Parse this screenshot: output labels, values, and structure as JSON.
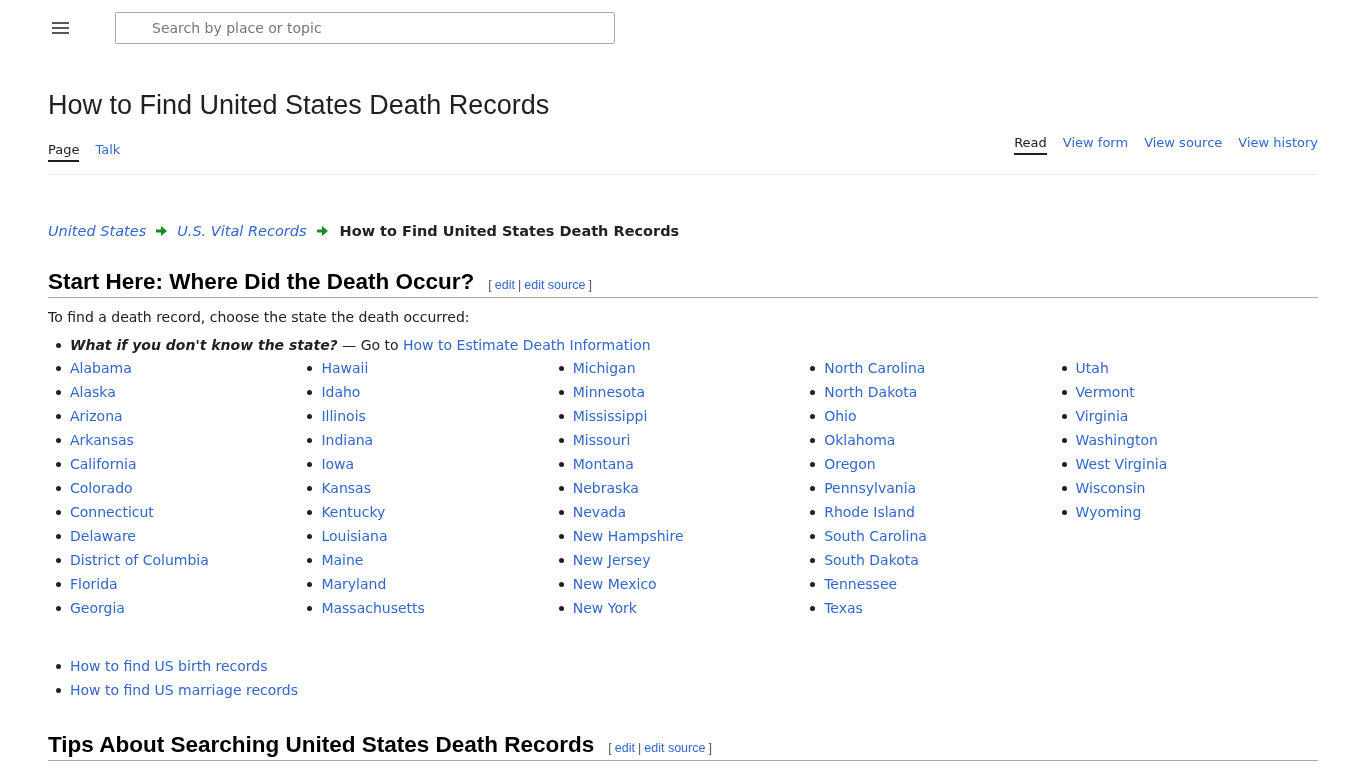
{
  "header": {
    "search": {
      "placeholder": "Search by place or topic"
    }
  },
  "page_title": "How to Find United States Death Records",
  "tabs_left": [
    {
      "label": "Page",
      "selected": true
    },
    {
      "label": "Talk",
      "selected": false
    }
  ],
  "tabs_right": [
    {
      "label": "Read",
      "selected": true
    },
    {
      "label": "View form",
      "selected": false
    },
    {
      "label": "View source",
      "selected": false
    },
    {
      "label": "View history",
      "selected": false
    }
  ],
  "breadcrumb": {
    "links": [
      "United States",
      "U.S. Vital Records"
    ],
    "current": "How to Find United States Death Records"
  },
  "sections": [
    {
      "heading": "Start Here: Where Did the Death Occur?",
      "edit": {
        "open": "[",
        "links": [
          "edit",
          "edit source"
        ],
        "separator": "|",
        "close": "]"
      },
      "intro": "To find a death record, choose the state the death occurred:",
      "tip": {
        "question": "What if you don't know the state?",
        "text": "— Go to",
        "link": "How to Estimate Death Information"
      },
      "state_columns": [
        [
          "Alabama",
          "Alaska",
          "Arizona",
          "Arkansas",
          "California",
          "Colorado",
          "Connecticut",
          "Delaware",
          "District of Columbia",
          "Florida",
          "Georgia"
        ],
        [
          "Hawaii",
          "Idaho",
          "Illinois",
          "Indiana",
          "Iowa",
          "Kansas",
          "Kentucky",
          "Louisiana",
          "Maine",
          "Maryland",
          "Massachusetts"
        ],
        [
          "Michigan",
          "Minnesota",
          "Mississippi",
          "Missouri",
          "Montana",
          "Nebraska",
          "Nevada",
          "New Hampshire",
          "New Jersey",
          "New Mexico",
          "New York"
        ],
        [
          "North Carolina",
          "North Dakota",
          "Ohio",
          "Oklahoma",
          "Oregon",
          "Pennsylvania",
          "Rhode Island",
          "South Carolina",
          "South Dakota",
          "Tennessee",
          "Texas"
        ],
        [
          "Utah",
          "Vermont",
          "Virginia",
          "Washington",
          "West Virginia",
          "Wisconsin",
          "Wyoming"
        ]
      ],
      "related_links": [
        "How to find US birth records",
        "How to find US marriage records"
      ]
    },
    {
      "heading": "Tips About Searching United States Death Records",
      "edit": {
        "open": "[",
        "links": [
          "edit",
          "edit source"
        ],
        "separator": "|",
        "close": "]"
      }
    }
  ]
}
